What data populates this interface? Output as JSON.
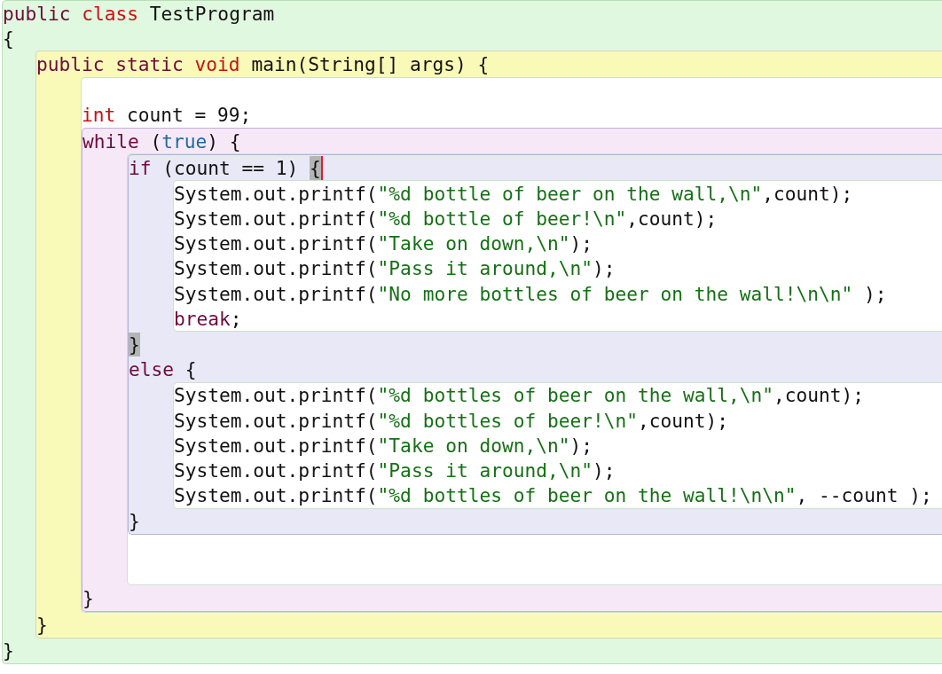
{
  "editor": {
    "items": [
      {
        "kind": "class_scope",
        "items": [
          {
            "kind": "line",
            "tokens": [
              {
                "kind": "keyword",
                "text": "public "
              },
              {
                "kind": "type",
                "text": "class"
              },
              {
                "kind": "plain",
                "text": " TestProgram"
              }
            ]
          },
          {
            "kind": "line",
            "tokens": [
              {
                "kind": "plain",
                "text": "{"
              }
            ]
          },
          {
            "kind": "method_scope",
            "items": [
              {
                "kind": "line",
                "tokens": [
                  {
                    "kind": "keyword",
                    "text": "public static "
                  },
                  {
                    "kind": "type",
                    "text": "void"
                  },
                  {
                    "kind": "plain",
                    "text": " main(String[] args) {"
                  }
                ]
              },
              {
                "kind": "body",
                "items": [
                  {
                    "kind": "blank"
                  },
                  {
                    "kind": "line",
                    "tokens": [
                      {
                        "kind": "type",
                        "text": "int"
                      },
                      {
                        "kind": "plain",
                        "text": " count = 99;"
                      }
                    ]
                  },
                  {
                    "kind": "loop_scope",
                    "items": [
                      {
                        "kind": "line",
                        "tokens": [
                          {
                            "kind": "keyword",
                            "text": "while"
                          },
                          {
                            "kind": "plain",
                            "text": " ("
                          },
                          {
                            "kind": "literal",
                            "text": "true"
                          },
                          {
                            "kind": "plain",
                            "text": ") {"
                          }
                        ]
                      },
                      {
                        "kind": "body",
                        "items": [
                          {
                            "kind": "branch_scope",
                            "items": [
                              {
                                "kind": "line",
                                "tokens": [
                                  {
                                    "kind": "keyword",
                                    "text": "if"
                                  },
                                  {
                                    "kind": "plain",
                                    "text": " (count == 1) "
                                  },
                                  {
                                    "kind": "match",
                                    "text": "{"
                                  },
                                  {
                                    "kind": "caret"
                                  }
                                ]
                              },
                              {
                                "kind": "body",
                                "items": [
                                  {
                                    "kind": "line",
                                    "tokens": [
                                      {
                                        "kind": "plain",
                                        "text": "System.out.printf("
                                      },
                                      {
                                        "kind": "string",
                                        "text": "\"%d bottle of beer on the wall,\\n\""
                                      },
                                      {
                                        "kind": "plain",
                                        "text": ",count);"
                                      }
                                    ]
                                  },
                                  {
                                    "kind": "line",
                                    "tokens": [
                                      {
                                        "kind": "plain",
                                        "text": "System.out.printf("
                                      },
                                      {
                                        "kind": "string",
                                        "text": "\"%d bottle of beer!\\n\""
                                      },
                                      {
                                        "kind": "plain",
                                        "text": ",count);"
                                      }
                                    ]
                                  },
                                  {
                                    "kind": "line",
                                    "tokens": [
                                      {
                                        "kind": "plain",
                                        "text": "System.out.printf("
                                      },
                                      {
                                        "kind": "string",
                                        "text": "\"Take on down,\\n\""
                                      },
                                      {
                                        "kind": "plain",
                                        "text": ");"
                                      }
                                    ]
                                  },
                                  {
                                    "kind": "line",
                                    "tokens": [
                                      {
                                        "kind": "plain",
                                        "text": "System.out.printf("
                                      },
                                      {
                                        "kind": "string",
                                        "text": "\"Pass it around,\\n\""
                                      },
                                      {
                                        "kind": "plain",
                                        "text": ");"
                                      }
                                    ]
                                  },
                                  {
                                    "kind": "line",
                                    "tokens": [
                                      {
                                        "kind": "plain",
                                        "text": "System.out.printf("
                                      },
                                      {
                                        "kind": "string",
                                        "text": "\"No more bottles of beer on the wall!\\n\\n\""
                                      },
                                      {
                                        "kind": "plain",
                                        "text": " );"
                                      }
                                    ]
                                  },
                                  {
                                    "kind": "line",
                                    "tokens": [
                                      {
                                        "kind": "keyword",
                                        "text": "break"
                                      },
                                      {
                                        "kind": "plain",
                                        "text": ";"
                                      }
                                    ]
                                  }
                                ]
                              },
                              {
                                "kind": "line",
                                "tokens": [
                                  {
                                    "kind": "match",
                                    "text": "}"
                                  }
                                ]
                              },
                              {
                                "kind": "line",
                                "tokens": [
                                  {
                                    "kind": "keyword",
                                    "text": "else"
                                  },
                                  {
                                    "kind": "plain",
                                    "text": " {"
                                  }
                                ]
                              },
                              {
                                "kind": "body",
                                "items": [
                                  {
                                    "kind": "line",
                                    "tokens": [
                                      {
                                        "kind": "plain",
                                        "text": "System.out.printf("
                                      },
                                      {
                                        "kind": "string",
                                        "text": "\"%d bottles of beer on the wall,\\n\""
                                      },
                                      {
                                        "kind": "plain",
                                        "text": ",count);"
                                      }
                                    ]
                                  },
                                  {
                                    "kind": "line",
                                    "tokens": [
                                      {
                                        "kind": "plain",
                                        "text": "System.out.printf("
                                      },
                                      {
                                        "kind": "string",
                                        "text": "\"%d bottles of beer!\\n\""
                                      },
                                      {
                                        "kind": "plain",
                                        "text": ",count);"
                                      }
                                    ]
                                  },
                                  {
                                    "kind": "line",
                                    "tokens": [
                                      {
                                        "kind": "plain",
                                        "text": "System.out.printf("
                                      },
                                      {
                                        "kind": "string",
                                        "text": "\"Take on down,\\n\""
                                      },
                                      {
                                        "kind": "plain",
                                        "text": ");"
                                      }
                                    ]
                                  },
                                  {
                                    "kind": "line",
                                    "tokens": [
                                      {
                                        "kind": "plain",
                                        "text": "System.out.printf("
                                      },
                                      {
                                        "kind": "string",
                                        "text": "\"Pass it around,\\n\""
                                      },
                                      {
                                        "kind": "plain",
                                        "text": ");"
                                      }
                                    ]
                                  },
                                  {
                                    "kind": "line",
                                    "tokens": [
                                      {
                                        "kind": "plain",
                                        "text": "System.out.printf("
                                      },
                                      {
                                        "kind": "string",
                                        "text": "\"%d bottles of beer on the wall!\\n\\n\""
                                      },
                                      {
                                        "kind": "plain",
                                        "text": ", --count );"
                                      }
                                    ]
                                  }
                                ]
                              },
                              {
                                "kind": "line",
                                "tokens": [
                                  {
                                    "kind": "plain",
                                    "text": "}"
                                  }
                                ]
                              }
                            ]
                          },
                          {
                            "kind": "blank"
                          },
                          {
                            "kind": "blank"
                          }
                        ]
                      },
                      {
                        "kind": "line",
                        "tokens": [
                          {
                            "kind": "plain",
                            "text": "}"
                          }
                        ]
                      }
                    ]
                  }
                ]
              },
              {
                "kind": "line",
                "tokens": [
                  {
                    "kind": "plain",
                    "text": "}"
                  }
                ]
              }
            ]
          },
          {
            "kind": "line",
            "tokens": [
              {
                "kind": "plain",
                "text": "}"
              }
            ]
          }
        ]
      }
    ]
  }
}
